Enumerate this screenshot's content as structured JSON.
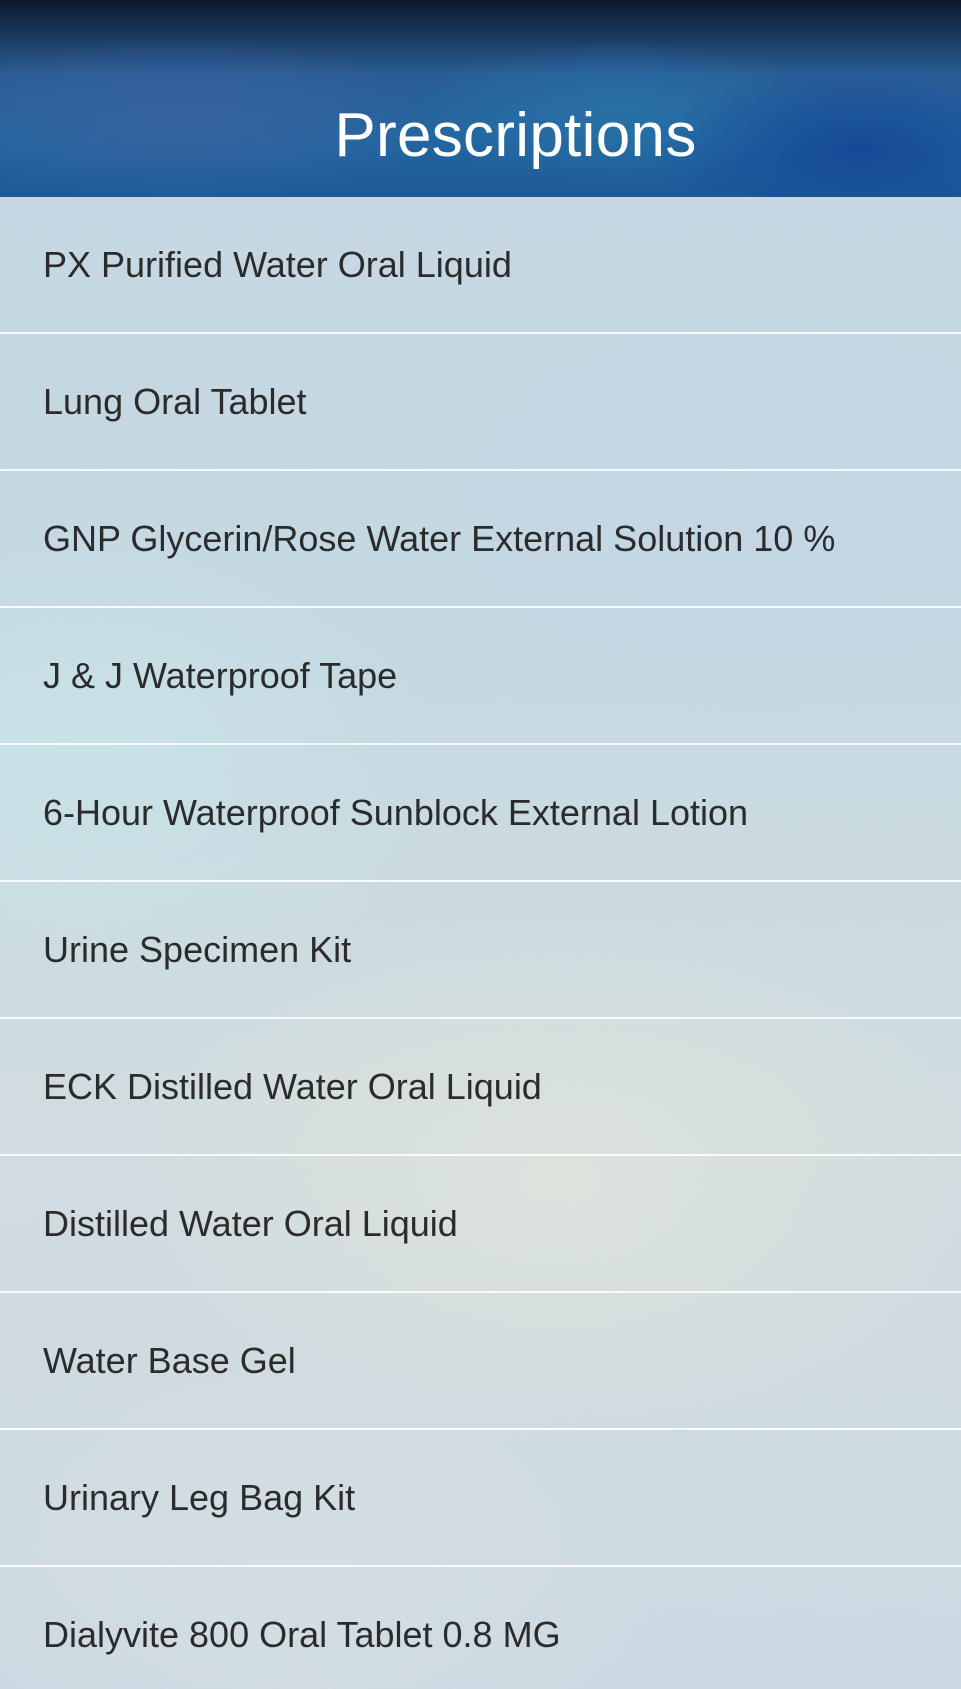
{
  "header": {
    "title": "Prescriptions"
  },
  "prescriptions": [
    {
      "label": "PX Purified Water Oral Liquid"
    },
    {
      "label": "Lung Oral Tablet"
    },
    {
      "label": "GNP Glycerin/Rose Water External Solution 10 %"
    },
    {
      "label": "J & J Waterproof Tape"
    },
    {
      "label": "6-Hour Waterproof Sunblock External Lotion"
    },
    {
      "label": "Urine Specimen Kit"
    },
    {
      "label": "ECK Distilled Water Oral Liquid"
    },
    {
      "label": "Distilled Water Oral Liquid"
    },
    {
      "label": "Water Base Gel"
    },
    {
      "label": "Urinary Leg Bag Kit"
    },
    {
      "label": "Dialyvite 800 Oral Tablet 0.8 MG"
    }
  ],
  "colors": {
    "header_blue": "#2466a0",
    "text": "#2b2b2b",
    "divider": "#ffffff"
  }
}
